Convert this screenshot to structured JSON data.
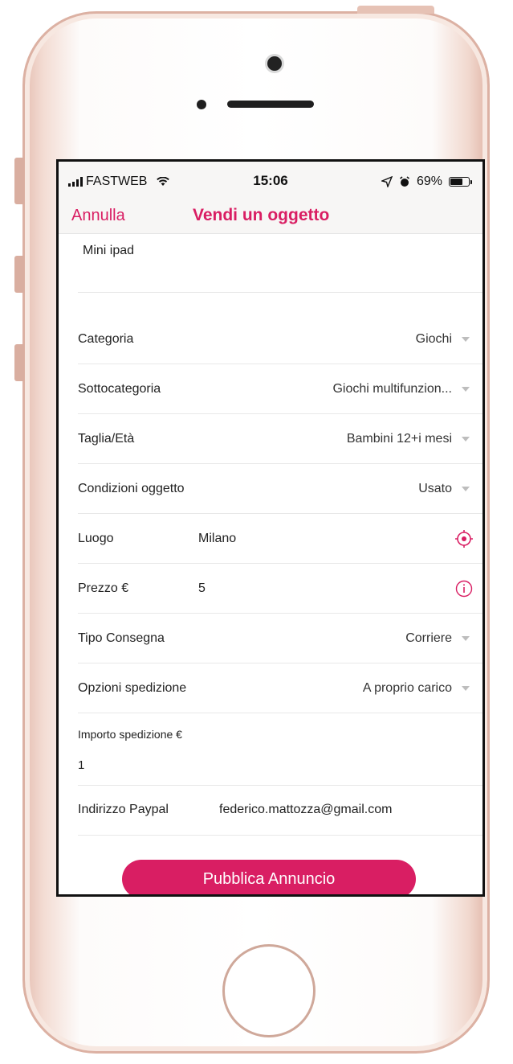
{
  "status_bar": {
    "carrier": "FASTWEB",
    "time": "15:06",
    "battery": "69%"
  },
  "nav": {
    "cancel_label": "Annulla",
    "title": "Vendi un oggetto"
  },
  "form": {
    "item_title": "Mini ipad",
    "fields": [
      {
        "label": "Categoria",
        "value": "Giochi"
      },
      {
        "label": "Sottocategoria",
        "value": "Giochi multifunzion..."
      },
      {
        "label": "Taglia/Età",
        "value": "Bambini 12+i mesi"
      },
      {
        "label": "Condizioni oggetto",
        "value": "Usato"
      }
    ],
    "location": {
      "label": "Luogo",
      "value": "Milano"
    },
    "price": {
      "label": "Prezzo €",
      "value": "5"
    },
    "delivery_type": {
      "label": "Tipo Consegna",
      "value": "Corriere"
    },
    "shipping_options": {
      "label": "Opzioni spedizione",
      "value": "A proprio carico"
    },
    "shipping_amount": {
      "label": "Importo spedizione €",
      "value": "1"
    },
    "paypal": {
      "label": "Indirizzo Paypal",
      "value": "federico.mattozza@gmail.com"
    }
  },
  "actions": {
    "publish_label": "Pubblica Annuncio"
  },
  "colors": {
    "accent": "#d91e63",
    "phone_rose_gold": "#e6c0b4"
  }
}
